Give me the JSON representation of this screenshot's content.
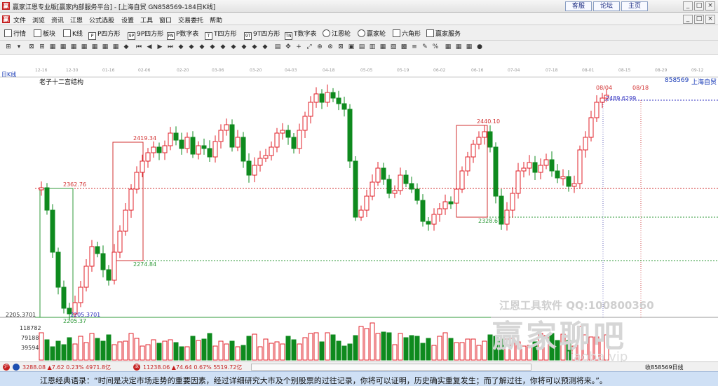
{
  "window": {
    "title": "赢家江恩专业版[赢家内部服务平台] - [上海自贸  GN858569-184日K线]",
    "links": [
      "客服",
      "论坛",
      "主页"
    ],
    "controls": [
      "_",
      "□",
      "×"
    ]
  },
  "menu": [
    "文件",
    "浏览",
    "资讯",
    "江恩",
    "公式选股",
    "设置",
    "工具",
    "窗口",
    "交易委托",
    "帮助"
  ],
  "toolbar": [
    "行情",
    "板块",
    "K线",
    "P四方形",
    "9P四方形",
    "P数字表",
    "T四方形",
    "9T四方形",
    "T数字表",
    "江恩轮",
    "赢家轮",
    "六角形",
    "赢家服务"
  ],
  "chart": {
    "period_label": "日K线",
    "study_title": "老子十二宫结构",
    "stock_code": "858569",
    "stock_name": "上海自贸",
    "date_axis": [
      "12-16",
      "12-30",
      "01-16",
      "02-06",
      "02-20",
      "03-06",
      "03-20",
      "04-03",
      "04-18",
      "05-05",
      "05-19",
      "06-02",
      "06-16",
      "07-04",
      "07-18",
      "08-01",
      "08-15",
      "08-29",
      "09-12"
    ],
    "price_labels": {
      "left_low": "2205.3701",
      "box1_high": "2362.76",
      "box1_low": "2205.3701",
      "box1_low2": "2205.37",
      "box2_high": "2419.34",
      "box2_low": "2274.84",
      "box3_high": "2440.10",
      "box3_low": "2328.67",
      "current_line": "2489.6299",
      "date_a": "08/04",
      "date_b": "08/18"
    },
    "volume_ticks": [
      "118782",
      "79188",
      "39594"
    ],
    "colors": {
      "up": "#e0202a",
      "down": "#0e8a1e",
      "box_red": "#d23030",
      "box_green": "#2f9a3a",
      "line_blue": "#3030c0"
    }
  },
  "watermark": {
    "line1": "江恩工具软件  QQ:100800360",
    "logo": "赢家聊吧",
    "url": "liaoba.vip"
  },
  "statusbar": {
    "sh_index": "3288.08 ▲7.62 0.23% 4971.8亿",
    "sz_index": "11238.06 ▲74.64 0.67% 5519.72亿",
    "right": "收858569日线"
  },
  "quote_bar": "江恩经典语录：“时间是决定市场走势的重要因素，经过详细研究大市及个别股票的过往记录，你将可以证明，历史确实重复发生；而了解过往，你将可以预测将来。”。"
}
